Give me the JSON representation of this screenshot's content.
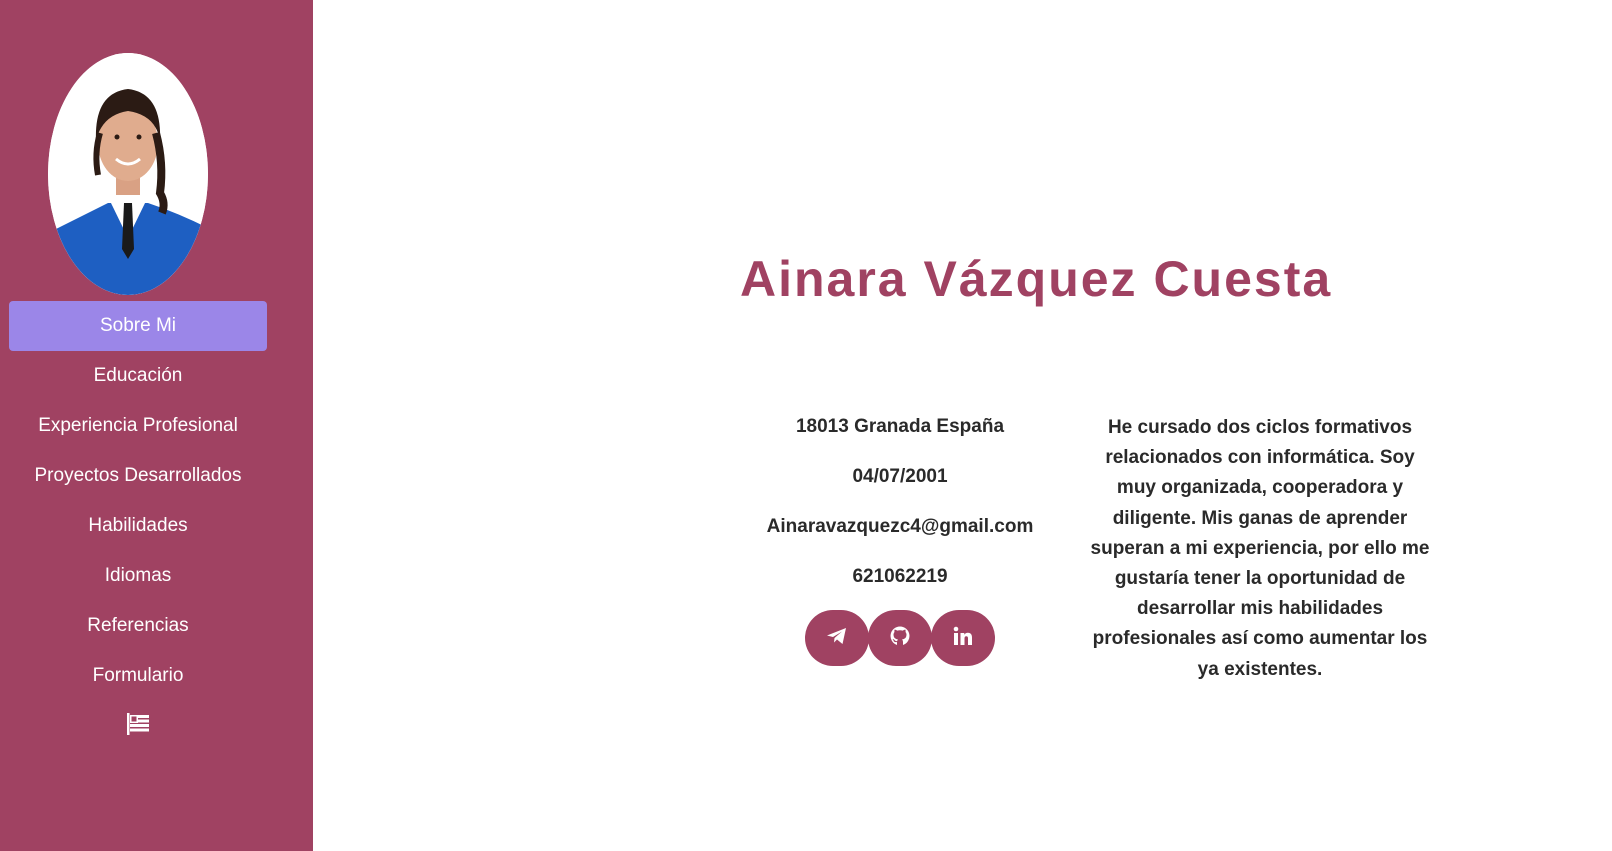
{
  "sidebar": {
    "avatar_alt": "Ainara Vázquez Cuesta",
    "items": [
      {
        "label": "Sobre Mi",
        "active": true
      },
      {
        "label": "Educación",
        "active": false
      },
      {
        "label": "Experiencia Profesional",
        "active": false
      },
      {
        "label": "Proyectos Desarrollados",
        "active": false
      },
      {
        "label": "Habilidades",
        "active": false
      },
      {
        "label": "Idiomas",
        "active": false
      },
      {
        "label": "Referencias",
        "active": false
      },
      {
        "label": "Formulario",
        "active": false
      }
    ],
    "language_icon": "flag-icon"
  },
  "main": {
    "name": "Ainara Vázquez Cuesta",
    "contact": {
      "address": "18013 Granada España",
      "birthdate": "04/07/2001",
      "email": "Ainaravazquezc4@gmail.com",
      "phone": "621062219"
    },
    "socials": [
      {
        "icon": "telegram-icon"
      },
      {
        "icon": "github-icon"
      },
      {
        "icon": "linkedin-icon"
      }
    ],
    "about": "He cursado dos ciclos formativos relacionados con informática. Soy muy organizada, cooperadora y diligente. Mis ganas de aprender superan a mi experiencia, por ello me gustaría tener la oportunidad de desarrollar mis habilidades profesionales así como aumentar los ya existentes."
  },
  "colors": {
    "brand": "#a04262",
    "active_nav": "#9b86e8",
    "text": "#2a2a2a"
  }
}
